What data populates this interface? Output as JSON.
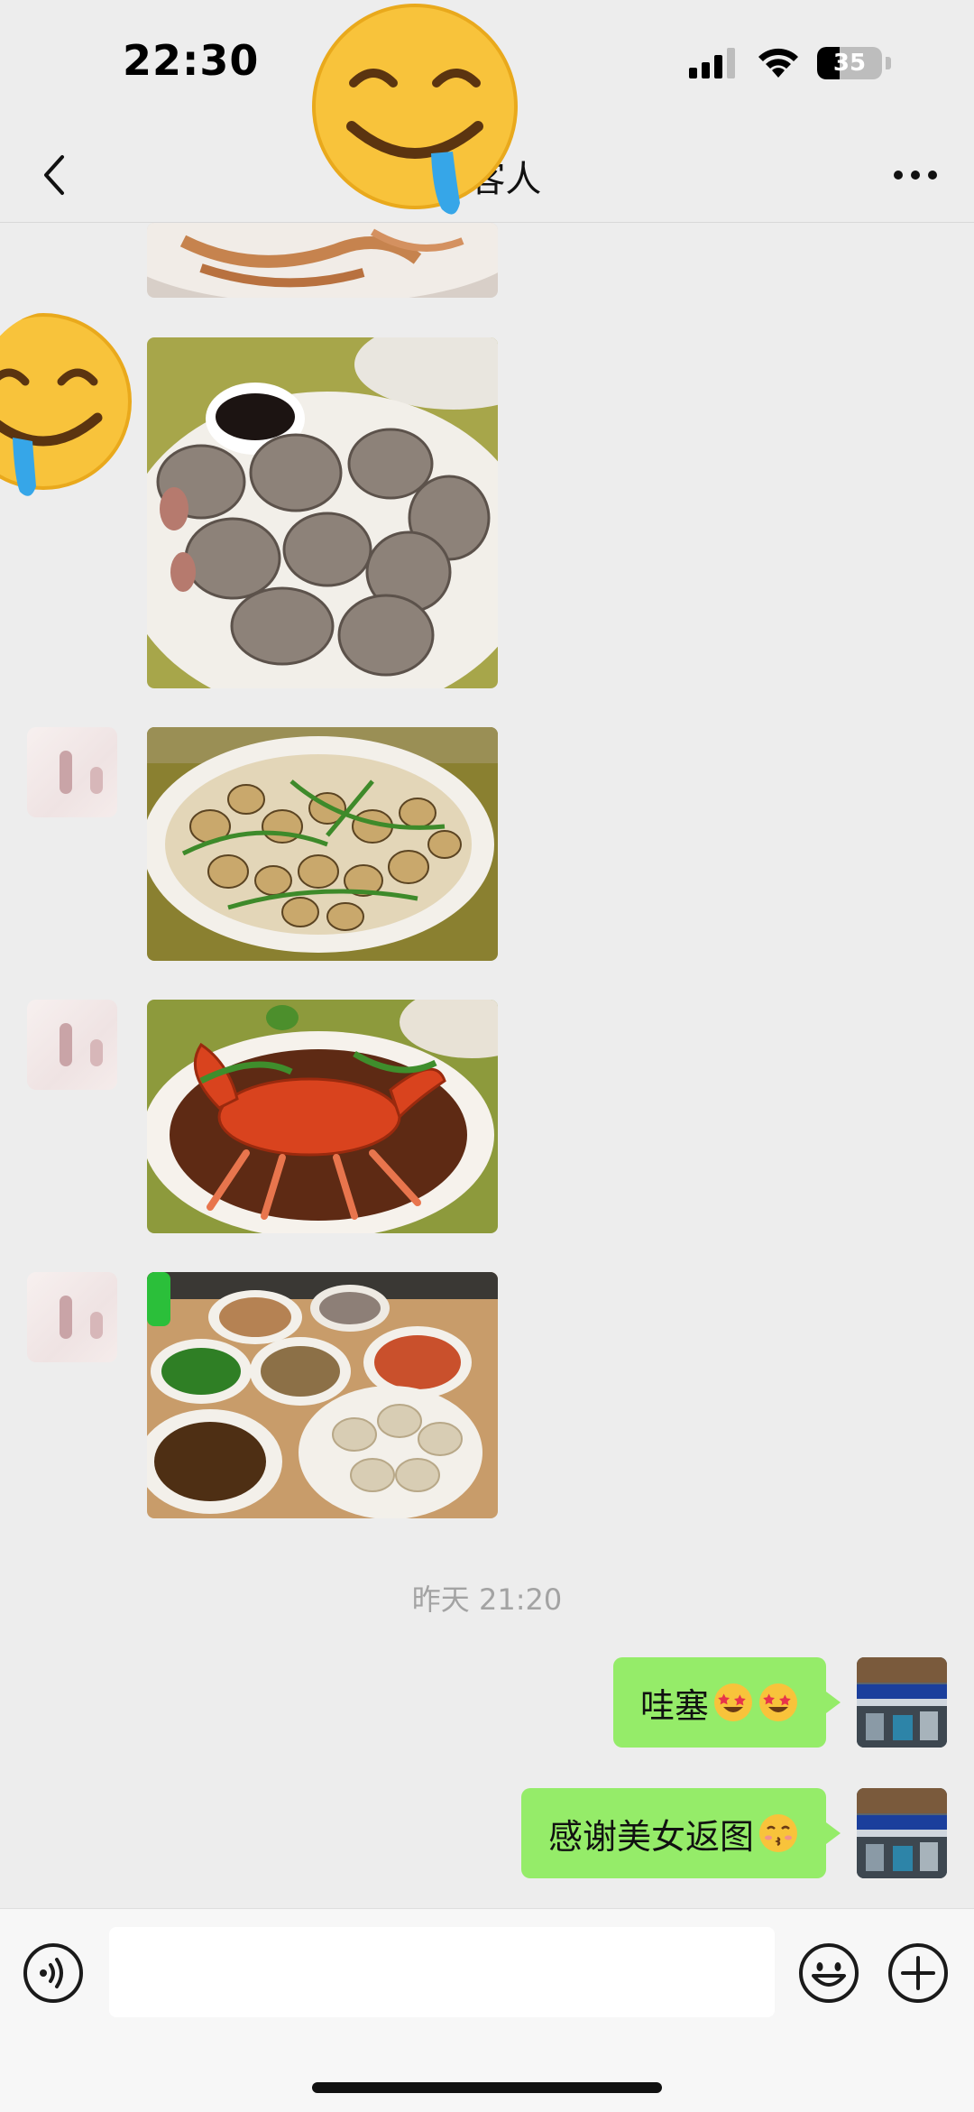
{
  "status_bar": {
    "time": "22:30",
    "battery_level": "35",
    "battery_fraction": 0.35
  },
  "nav": {
    "title": "C 客人",
    "back_icon": "chevron-left-icon",
    "more_icon": "more-icon"
  },
  "stickers": {
    "header_sticker": "drooling-face-icon",
    "side_sticker": "drooling-face-icon"
  },
  "messages": {
    "photo_descriptions": [
      "shrimp-photo",
      "whelk-photo",
      "stir-fried-snails-photo",
      "crab-photo",
      "seafood-table-photo"
    ],
    "timestamp": "昨天 21:20",
    "sent": [
      {
        "text": "哇塞",
        "emojis": [
          "star-struck-icon",
          "star-struck-icon"
        ]
      },
      {
        "text": "感谢美女返图",
        "emojis": [
          "kissing-face-icon"
        ]
      }
    ]
  },
  "input_bar": {
    "text_value": "",
    "voice_icon": "voice-icon",
    "emoji_icon": "emoji-icon",
    "plus_icon": "plus-icon"
  },
  "colors": {
    "background": "#ededed",
    "sent_bubble": "#95ec69",
    "timestamp": "#a3a3a3"
  }
}
